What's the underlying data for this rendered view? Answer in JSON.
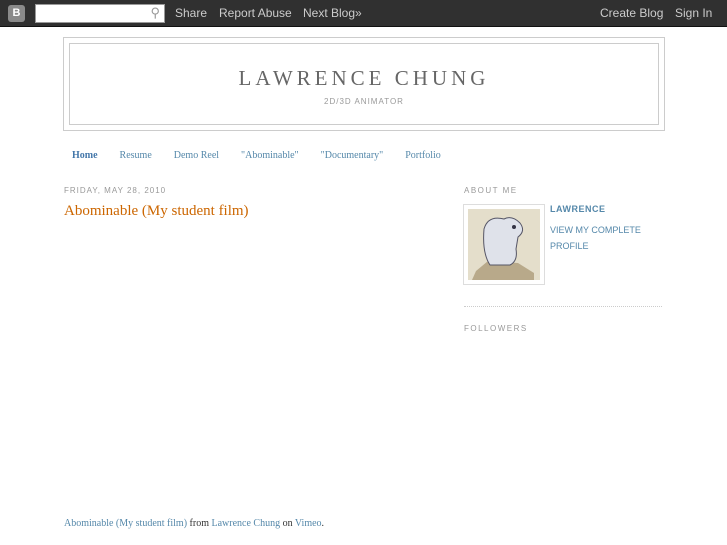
{
  "navbar": {
    "logo": "B",
    "search_icon": "search-icon",
    "share": "Share",
    "report_abuse": "Report Abuse",
    "next_blog": "Next Blog»",
    "create_blog": "Create Blog",
    "sign_in": "Sign In"
  },
  "header": {
    "title": "LAWRENCE CHUNG",
    "description": "2D/3D ANIMATOR"
  },
  "tabs": [
    "Home",
    "Resume",
    "Demo Reel",
    "\"Abominable\"",
    "\"Documentary\"",
    "Portfolio"
  ],
  "post": {
    "date": "FRIDAY, MAY 28, 2010",
    "title": "Abominable (My student film)",
    "credit": {
      "video": "Abominable (My student film)",
      "from": " from ",
      "author": "Lawrence Chung",
      "on": " on ",
      "site": "Vimeo",
      "end": "."
    }
  },
  "sidebar": {
    "about_heading": "ABOUT ME",
    "name": "LAWRENCE",
    "profile_link": "VIEW MY COMPLETE PROFILE",
    "followers_heading": "FOLLOWERS"
  }
}
